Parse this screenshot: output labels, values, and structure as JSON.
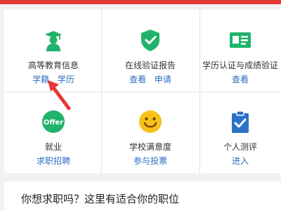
{
  "colors": {
    "accent_red": "#e53935",
    "green": "#21b36b",
    "link_blue": "#2a6ebf",
    "yellow": "#f7c11a",
    "check_blue": "#2b73c7"
  },
  "cards": [
    {
      "title": "高等教育信息",
      "icon": "graduate-icon",
      "links": [
        "学籍",
        "学历"
      ]
    },
    {
      "title": "在线验证报告",
      "icon": "shield-check-icon",
      "links": [
        "查看",
        "申请"
      ]
    },
    {
      "title": "学历认证与成绩验证",
      "icon": "certificate-card-icon",
      "links": [
        "查看"
      ]
    },
    {
      "title": "就业",
      "icon": "offer-icon",
      "icon_text": "Offer",
      "links": [
        "求职招聘"
      ]
    },
    {
      "title": "学校满意度",
      "icon": "smiley-icon",
      "links": [
        "参与投票"
      ]
    },
    {
      "title": "个人测评",
      "icon": "clipboard-check-icon",
      "links": [
        "进入"
      ]
    }
  ],
  "bottom": {
    "text": "你想求职吗？这里有适合你的职位"
  }
}
